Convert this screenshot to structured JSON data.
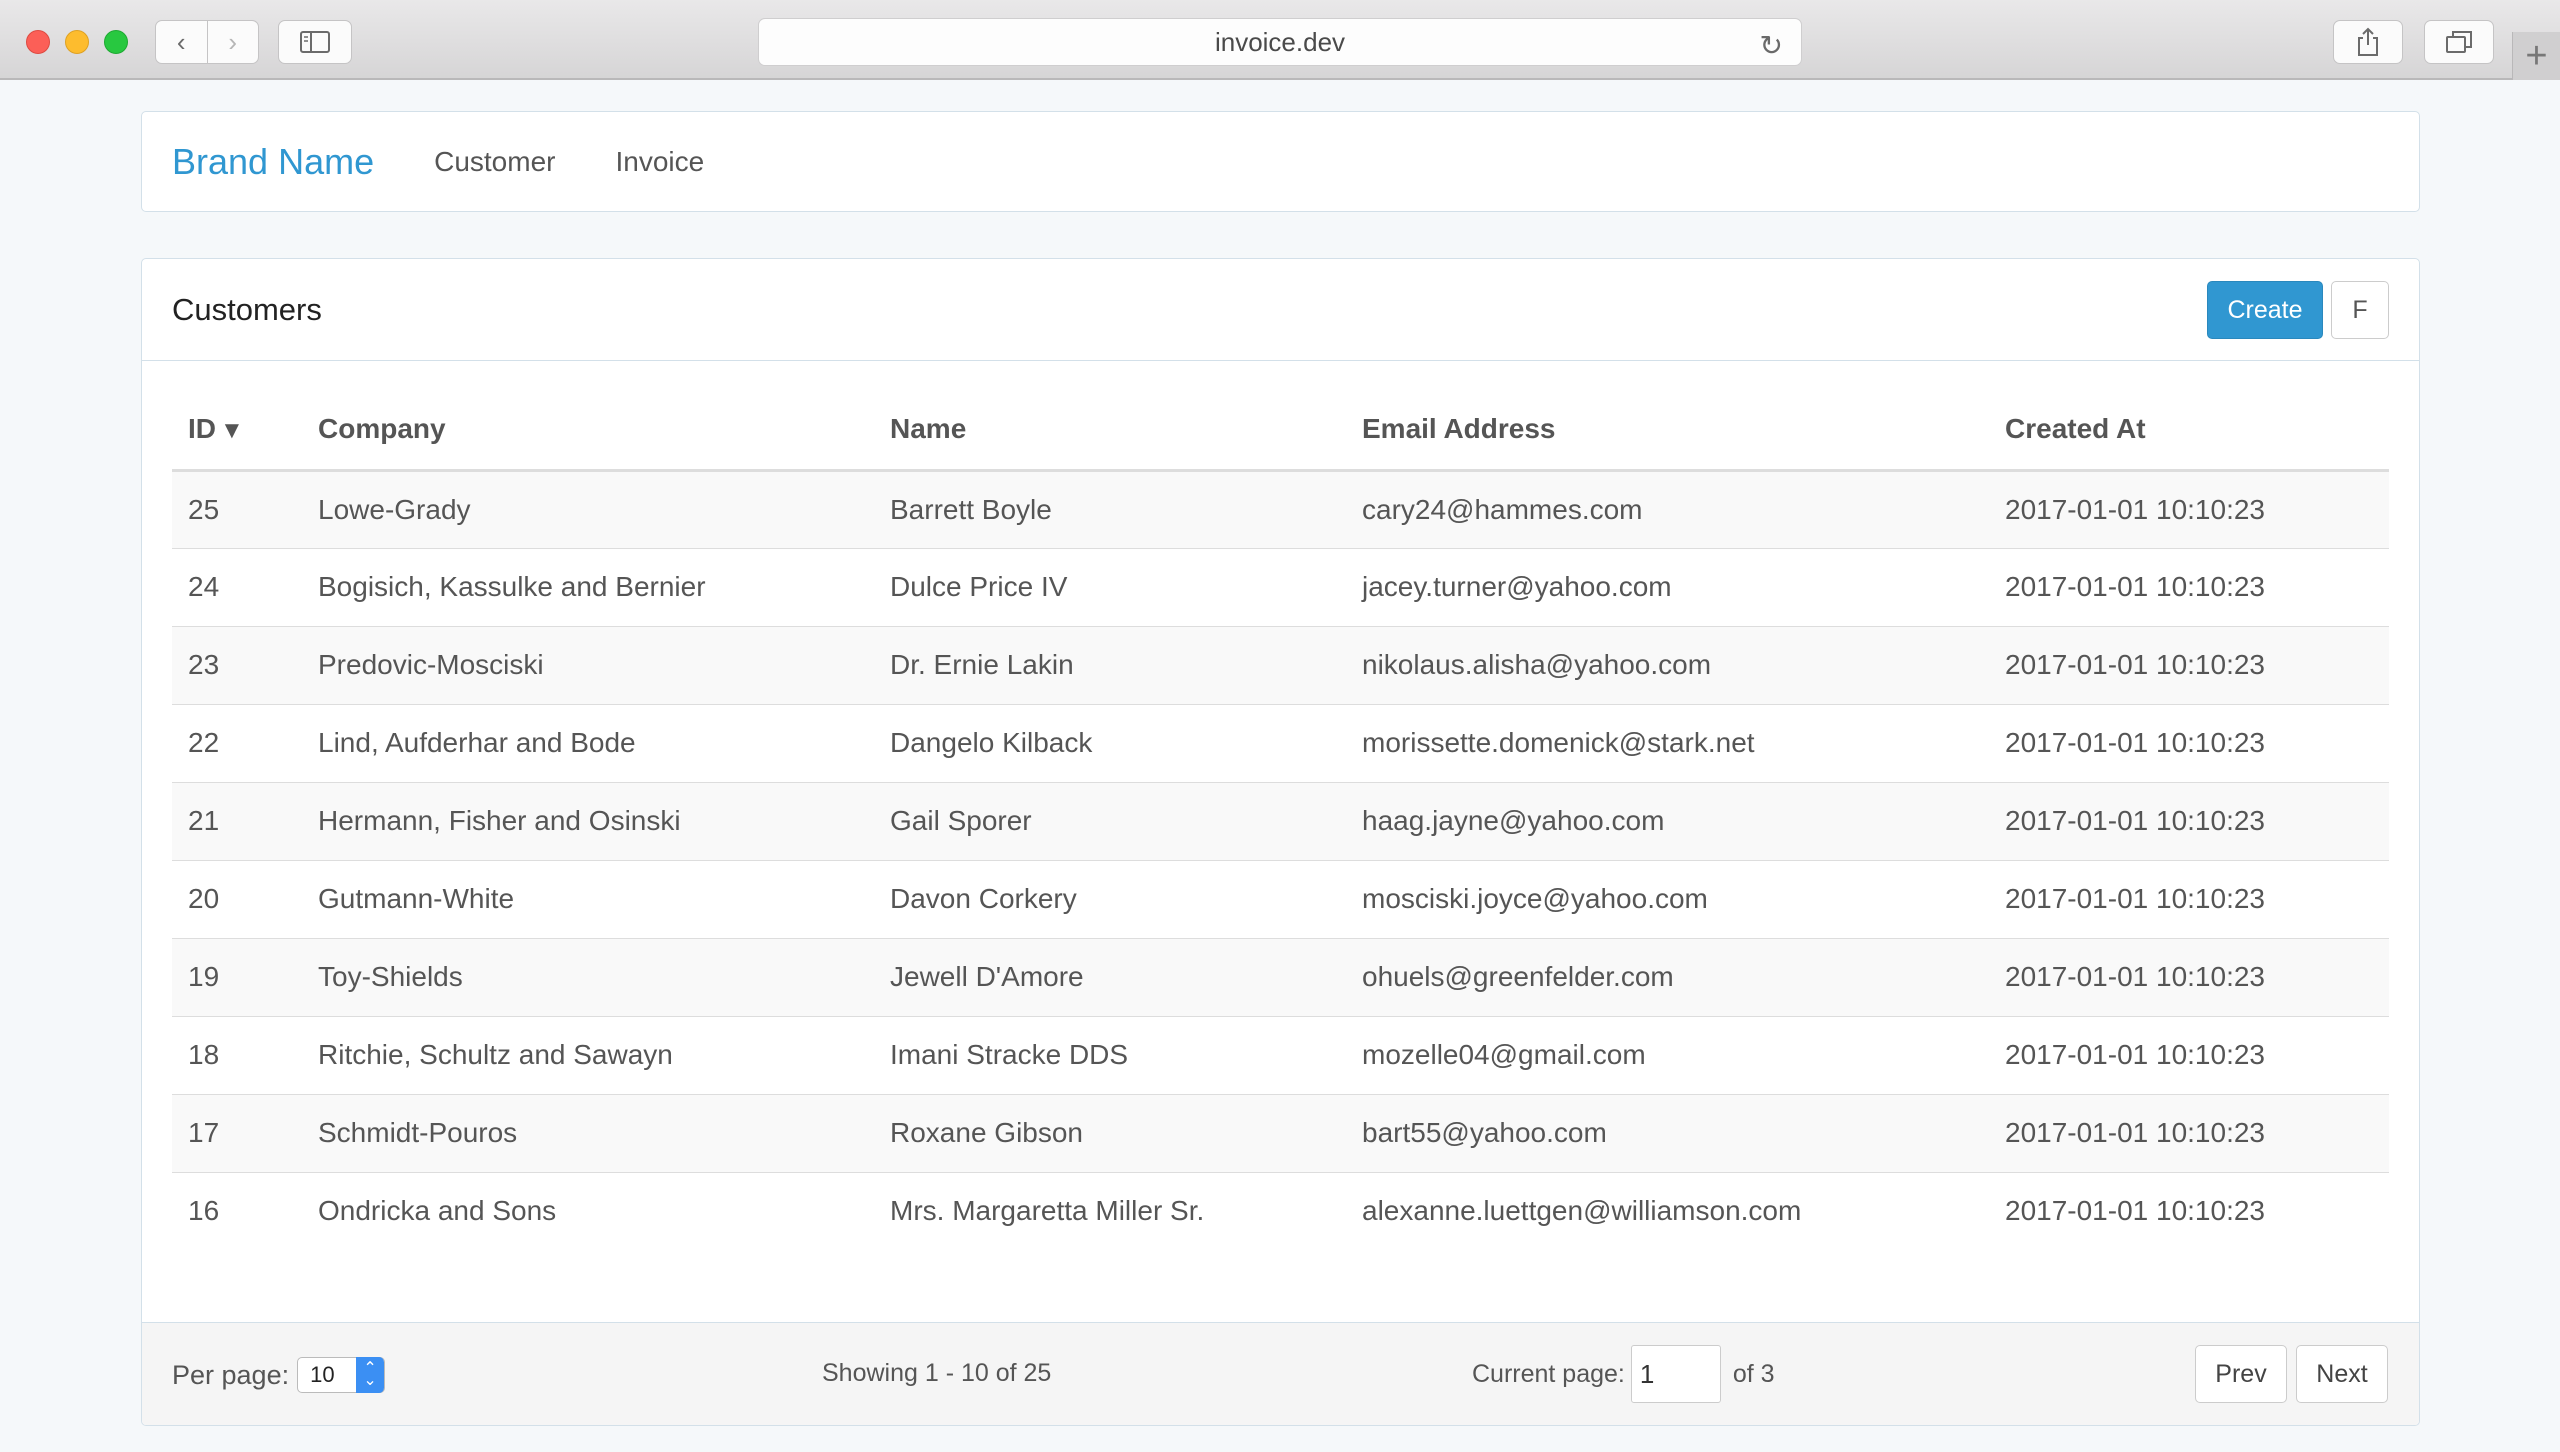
{
  "browser": {
    "url": "invoice.dev"
  },
  "navbar": {
    "brand": "Brand Name",
    "links": [
      "Customer",
      "Invoice"
    ]
  },
  "panel": {
    "title": "Customers",
    "create_label": "Create",
    "f_label": "F"
  },
  "table": {
    "columns": [
      "ID",
      "Company",
      "Name",
      "Email Address",
      "Created At"
    ],
    "sort_indicator": "▼",
    "rows": [
      [
        "25",
        "Lowe-Grady",
        "Barrett Boyle",
        "cary24@hammes.com",
        "2017-01-01 10:10:23"
      ],
      [
        "24",
        "Bogisich, Kassulke and Bernier",
        "Dulce Price IV",
        "jacey.turner@yahoo.com",
        "2017-01-01 10:10:23"
      ],
      [
        "23",
        "Predovic-Mosciski",
        "Dr. Ernie Lakin",
        "nikolaus.alisha@yahoo.com",
        "2017-01-01 10:10:23"
      ],
      [
        "22",
        "Lind, Aufderhar and Bode",
        "Dangelo Kilback",
        "morissette.domenick@stark.net",
        "2017-01-01 10:10:23"
      ],
      [
        "21",
        "Hermann, Fisher and Osinski",
        "Gail Sporer",
        "haag.jayne@yahoo.com",
        "2017-01-01 10:10:23"
      ],
      [
        "20",
        "Gutmann-White",
        "Davon Corkery",
        "mosciski.joyce@yahoo.com",
        "2017-01-01 10:10:23"
      ],
      [
        "19",
        "Toy-Shields",
        "Jewell D'Amore",
        "ohuels@greenfelder.com",
        "2017-01-01 10:10:23"
      ],
      [
        "18",
        "Ritchie, Schultz and Sawayn",
        "Imani Stracke DDS",
        "mozelle04@gmail.com",
        "2017-01-01 10:10:23"
      ],
      [
        "17",
        "Schmidt-Pouros",
        "Roxane Gibson",
        "bart55@yahoo.com",
        "2017-01-01 10:10:23"
      ],
      [
        "16",
        "Ondricka and Sons",
        "Mrs. Margaretta Miller Sr.",
        "alexanne.luettgen@williamson.com",
        "2017-01-01 10:10:23"
      ]
    ]
  },
  "footer": {
    "per_page_label": "Per page:",
    "per_page_value": "10",
    "showing": "Showing 1 - 10 of 25",
    "current_page_label": "Current page:",
    "current_page_value": "1",
    "of_total": "of 3",
    "prev_label": "Prev",
    "next_label": "Next"
  },
  "colors": {
    "brand": "#3097d1",
    "create_button": "#3097d1",
    "page_background": "#f5f8fa"
  }
}
